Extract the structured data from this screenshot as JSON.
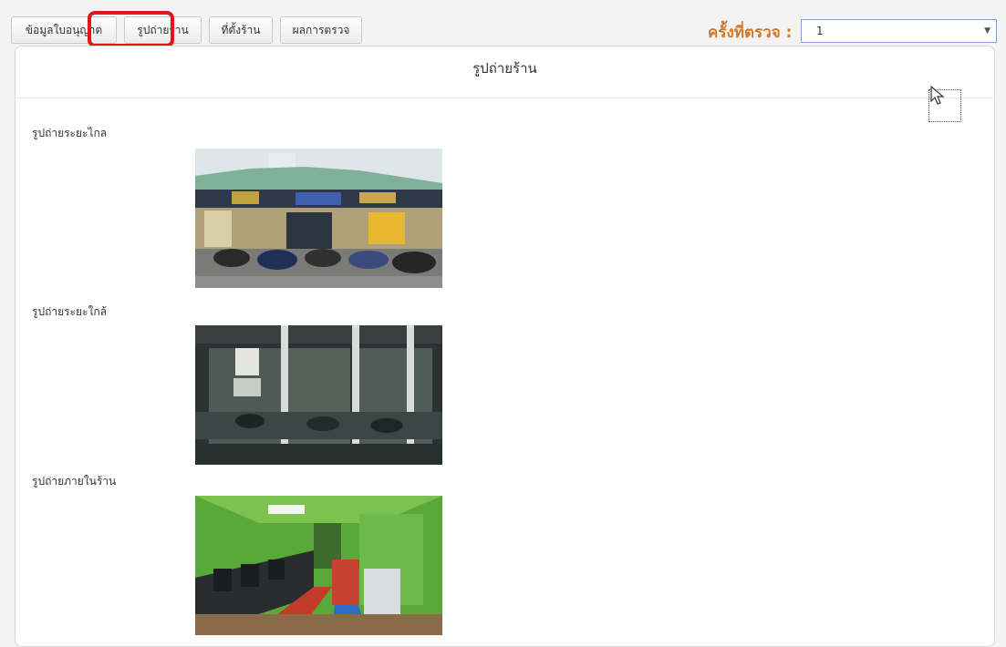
{
  "tabs": [
    {
      "label": "ข้อมูลใบอนุญาต"
    },
    {
      "label": "รูปถ่ายร้าน"
    },
    {
      "label": "ที่ตั้งร้าน"
    },
    {
      "label": "ผลการตรวจ"
    }
  ],
  "round": {
    "label": "ครั้งที่ตรวจ :",
    "selected": "1"
  },
  "panel": {
    "title": "รูปถ่ายร้าน",
    "photos": [
      {
        "label": "รูปถ่ายระยะไกล"
      },
      {
        "label": "รูปถ่ายระยะใกล้"
      },
      {
        "label": "รูปถ่ายภายในร้าน"
      }
    ]
  },
  "colors": {
    "highlight": "#e3141b",
    "round_label": "#d07a2c",
    "select_border": "#7aa7d6"
  }
}
